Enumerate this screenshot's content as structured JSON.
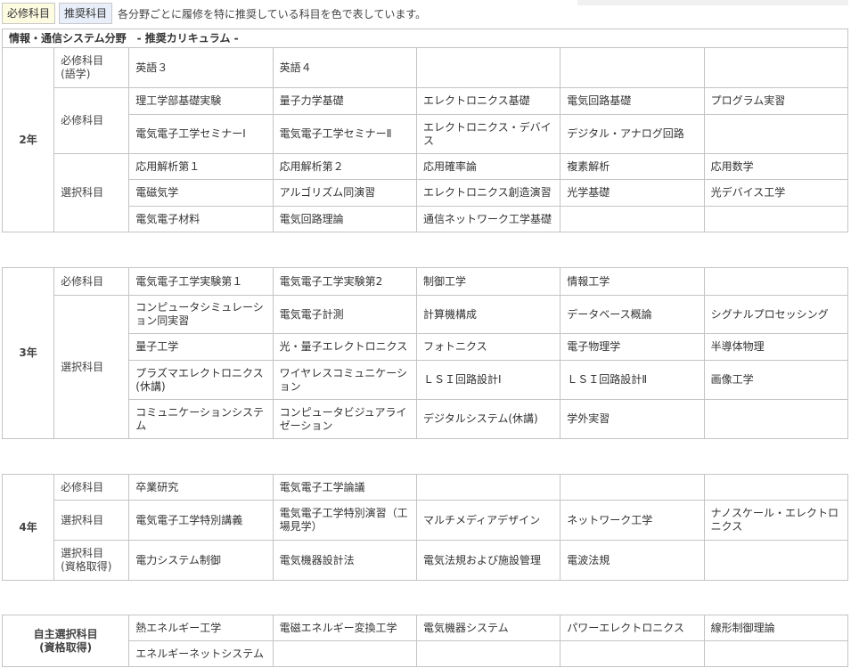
{
  "legend": {
    "required_chip": "必修科目",
    "recommended_chip": "推奨科目",
    "note": "各分野ごとに履修を特に推奨している科目を色で表しています。"
  },
  "header": "情報・通信システム分野　- 推奨カリキュラム -",
  "year2": {
    "year": "2年",
    "cat_lang": "必修科目\n(語学)",
    "cat_req": "必修科目",
    "cat_elec": "選択科目",
    "lang": [
      "英語３",
      "英語４"
    ],
    "req_row1": [
      "理工学部基礎実験",
      "量子力学基礎",
      "エレクトロニクス基礎",
      "電気回路基礎",
      "プログラム実習"
    ],
    "req_row2": [
      "電気電子工学セミナーⅠ",
      "電気電子工学セミナーⅡ",
      "エレクトロニクス・デバイス",
      "デジタル・アナログ回路"
    ],
    "elec_row1": [
      "応用解析第１",
      "応用解析第２",
      "応用確率論",
      "複素解析",
      "応用数学"
    ],
    "elec_row2": [
      "電磁気学",
      "アルゴリズム同演習",
      "エレクトロニクス創造演習",
      "光学基礎",
      "光デバイス工学"
    ],
    "elec_row3": [
      "電気電子材料",
      "電気回路理論",
      "通信ネットワーク工学基礎"
    ]
  },
  "year3": {
    "year": "3年",
    "cat_req": "必修科目",
    "cat_elec": "選択科目",
    "req_row": [
      "電気電子工学実験第１",
      "電気電子工学実験第2",
      "制御工学",
      "情報工学"
    ],
    "elec_row1": [
      "コンピュータシミュレーション同実習",
      "電気電子計測",
      "計算機構成",
      "データベース概論",
      "シグナルプロセッシング"
    ],
    "elec_row2": [
      "量子工学",
      "光・量子エレクトロニクス",
      "フォトニクス",
      "電子物理学",
      "半導体物理"
    ],
    "elec_row3": [
      "プラズマエレクトロニクス(休講)",
      "ワイヤレスコミュニケーション",
      "ＬＳＩ回路設計Ⅰ",
      "ＬＳＩ回路設計Ⅱ",
      "画像工学"
    ],
    "elec_row4": [
      "コミュニケーションシステム",
      "コンピュータビジュアライゼーション",
      "デジタルシステム(休講)",
      "学外実習"
    ]
  },
  "year4": {
    "year": "4年",
    "cat_req": "必修科目",
    "cat_elec": "選択科目",
    "cat_qual": "選択科目\n(資格取得)",
    "req_row": [
      "卒業研究",
      "電気電子工学論議"
    ],
    "elec_row": [
      "電気電子工学特別講義",
      "電気電子工学特別演習（工場見学）",
      "マルチメディアデザイン",
      "ネットワーク工学",
      "ナノスケール・エレクトロニクス"
    ],
    "qual_row": [
      "電力システム制御",
      "電気機器設計法",
      "電気法規および施設管理",
      "電波法規"
    ]
  },
  "self": {
    "label": "自主選択科目\n(資格取得)",
    "row1": [
      "熱エネルギー工学",
      "電磁エネルギー変換工学",
      "電気機器システム",
      "パワーエレクトロニクス",
      "線形制御理論"
    ],
    "row2": [
      "エネルギーネットシステム"
    ]
  }
}
